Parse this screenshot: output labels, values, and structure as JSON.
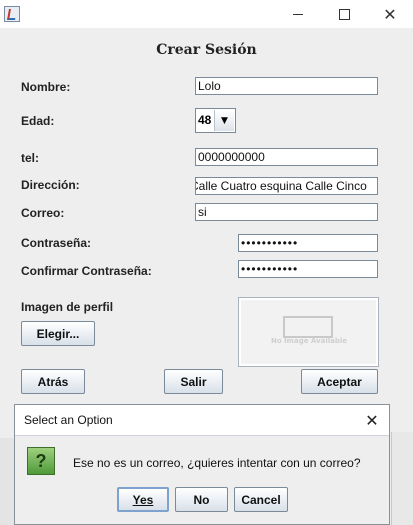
{
  "window": {
    "app_icon": "java-icon",
    "minimize_icon": "minimize-icon",
    "maximize_icon": "maximize-icon",
    "close_glyph": "✕"
  },
  "form": {
    "title": "Crear Sesión",
    "labels": {
      "nombre": "Nombre:",
      "edad": "Edad:",
      "tel": "tel:",
      "direccion": "Dirección:",
      "correo": "Correo:",
      "contrasena": "Contraseña:",
      "confirmar": "Confirmar Contraseña:",
      "imagen": "Imagen de perfil"
    },
    "values": {
      "nombre": "Lolo",
      "edad": "48",
      "tel": "0000000000",
      "direccion": "Calle Cuatro esquina Calle Cinco",
      "correo": "si",
      "contrasena": "•••••••••••",
      "confirmar": "•••••••••••"
    },
    "combo_arrow": "▼",
    "no_image_text": "No Image Available",
    "buttons": {
      "elegir": "Elegir...",
      "atras": "Atrás",
      "salir": "Salir",
      "aceptar": "Aceptar"
    }
  },
  "dialog": {
    "title": "Select an Option",
    "close_glyph": "✕",
    "icon_glyph": "?",
    "message": "Ese no es un correo, ¿quieres intentar con un correo?",
    "buttons": {
      "yes": "Yes",
      "no": "No",
      "cancel": "Cancel"
    }
  }
}
